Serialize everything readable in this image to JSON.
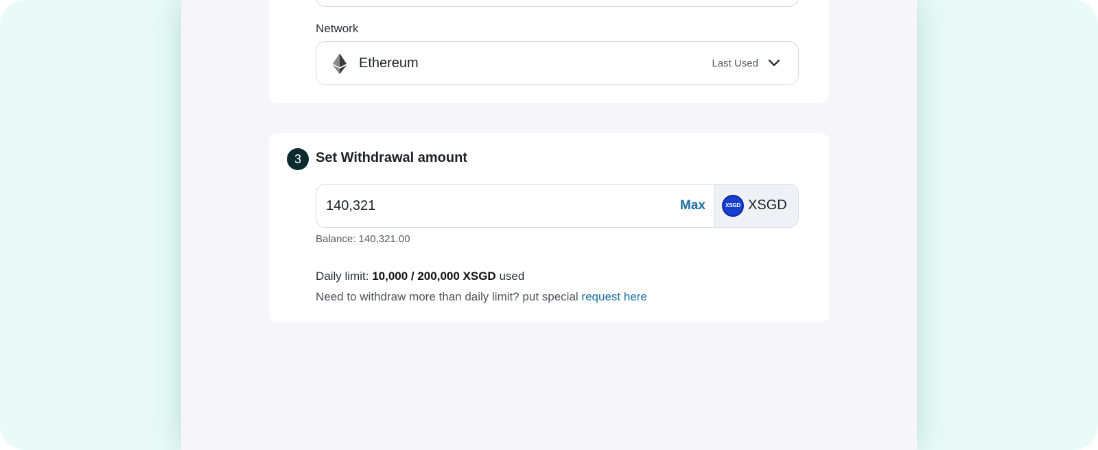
{
  "network": {
    "label": "Network",
    "selected_value": "Ethereum",
    "selected_tag": "Last Used",
    "icon": "ethereum-icon"
  },
  "withdrawal": {
    "step_number": "3",
    "title": "Set Withdrawal amount",
    "amount_value": "140,321",
    "max_label": "Max",
    "token": {
      "icon_text": "XSGD",
      "name": "XSGD"
    },
    "balance_text": "Balance: 140,321.00",
    "daily_limit_prefix": "Daily limit:",
    "daily_limit_value": "10,000 / 200,000 XSGD",
    "daily_limit_suffix": "used",
    "need_more_text": "Need to withdraw more than daily limit? put special",
    "request_link_label": "request here"
  },
  "colors": {
    "page_bg": "#eafbf7",
    "panel_bg": "#f6f6fa",
    "link": "#1b6fa0",
    "step_badge": "#0d2a2c",
    "token_blue": "#1a3fd0"
  }
}
